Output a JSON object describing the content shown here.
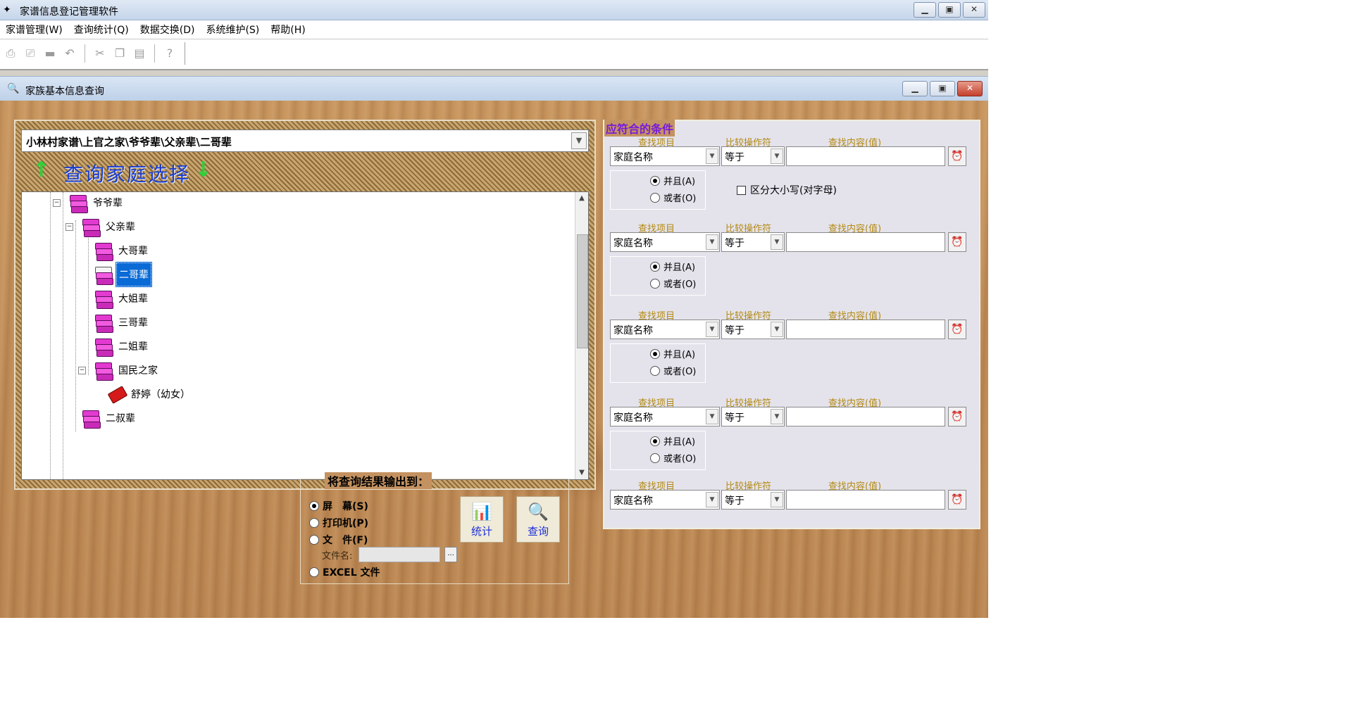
{
  "window": {
    "title": "家谱信息登记管理软件",
    "minimize": "▁",
    "restore": "▣",
    "close": "✕"
  },
  "menu": [
    "家谱管理(W)",
    "查询统计(Q)",
    "数据交换(D)",
    "系统维护(S)",
    "帮助(H)"
  ],
  "toolbar": {
    "icons": [
      "open-icon",
      "print-icon",
      "save-icon",
      "undo-icon",
      "cut-icon",
      "copy-icon",
      "paste-icon",
      "help-icon"
    ],
    "glyphs": [
      "⎙",
      "⎚",
      "▬",
      "↶",
      "✂",
      "❐",
      "▤",
      "?"
    ]
  },
  "child": {
    "title": "家族基本信息查询",
    "minimize": "▁",
    "restore": "▣",
    "close": "✕"
  },
  "family": {
    "path": "小林村家谱\\上官之家\\爷爷辈\\父亲辈\\二哥辈",
    "hint": "查询家庭选择",
    "up_arrow": "↑",
    "down_arrow": "↓",
    "nodes": [
      {
        "label": "爷爷辈",
        "level": 0,
        "expanded": true
      },
      {
        "label": "父亲辈",
        "level": 1,
        "expanded": true
      },
      {
        "label": "大哥辈",
        "level": 2
      },
      {
        "label": "二哥辈",
        "level": 2,
        "selected": true
      },
      {
        "label": "大姐辈",
        "level": 2
      },
      {
        "label": "三哥辈",
        "level": 2
      },
      {
        "label": "二姐辈",
        "level": 2
      },
      {
        "label": "国民之家",
        "level": 2,
        "expanded": true
      },
      {
        "label": "舒婷（幼女）",
        "level": 3
      },
      {
        "label": "二叔辈",
        "level": 1
      }
    ]
  },
  "output": {
    "legend": "将查询结果输出到：",
    "options": [
      "屏　幕(S)",
      "打印机(P)",
      "文　件(F)",
      "EXCEL 文件"
    ],
    "selected": 0,
    "filename_label": "文件名:",
    "browse": "...",
    "stat_button": "统计",
    "query_button": "查询"
  },
  "conditions": {
    "title": "应符合的条件",
    "col_item": "查找项目",
    "col_op": "比较操作符",
    "col_value": "查找内容(值)",
    "rows": [
      {
        "item": "家庭名称",
        "op": "等于",
        "value": ""
      },
      {
        "item": "家庭名称",
        "op": "等于",
        "value": ""
      },
      {
        "item": "家庭名称",
        "op": "等于",
        "value": ""
      },
      {
        "item": "家庭名称",
        "op": "等于",
        "value": ""
      },
      {
        "item": "家庭名称",
        "op": "等于",
        "value": ""
      }
    ],
    "and_label": "并且(A)",
    "or_label": "或者(O)",
    "case_label": "区分大小写(对字母)"
  },
  "colors": {
    "selection": "#0a6ad6",
    "hint": "#1a3ccc",
    "cond_title": "#7a1adb",
    "header": "#b48a12"
  }
}
